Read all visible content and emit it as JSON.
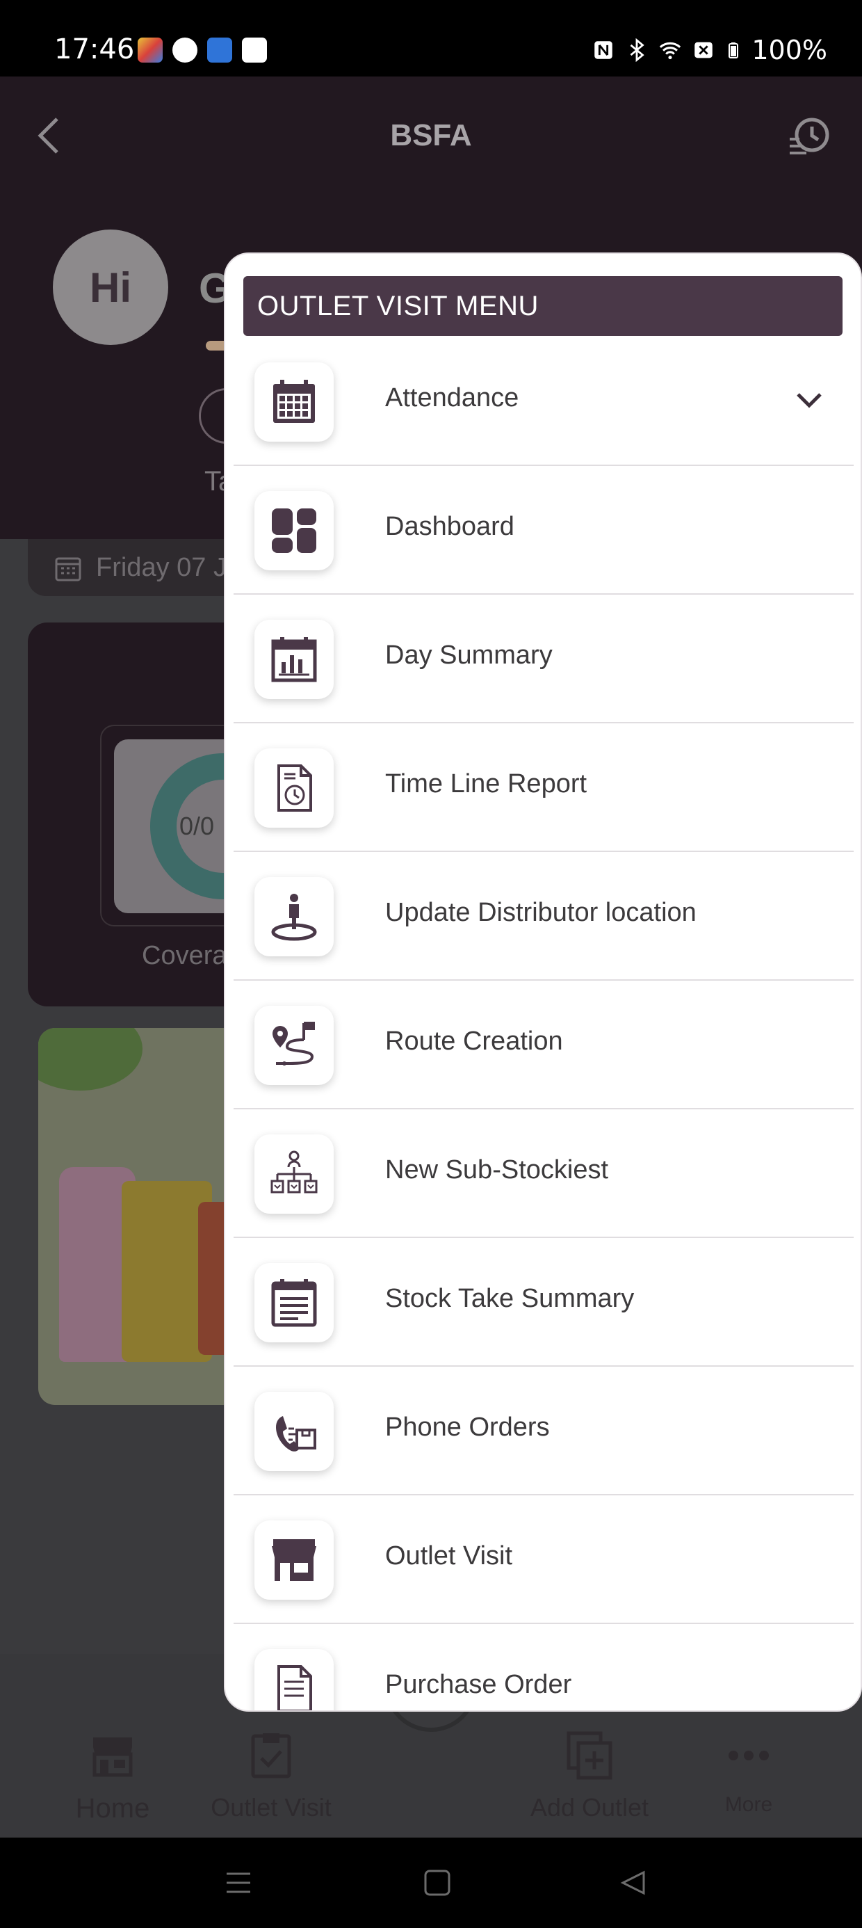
{
  "status_bar": {
    "time": "17:46",
    "battery": "100%",
    "icons": [
      "nfc-icon",
      "bluetooth-icon",
      "wifi-icon",
      "no-sim-icon",
      "battery-icon"
    ]
  },
  "app": {
    "title": "BSFA",
    "avatar_text": "Hi",
    "greeting_partial": "G",
    "tab_partial": "Ta",
    "date_partial": "Friday 07 J",
    "coverage_value": "0/0",
    "coverage_label_partial": "Covera"
  },
  "menu": {
    "header": "OUTLET VISIT MENU",
    "items": [
      {
        "label": "Attendance",
        "icon": "calendar-icon",
        "expandable": true
      },
      {
        "label": "Dashboard",
        "icon": "dashboard-icon"
      },
      {
        "label": "Day Summary",
        "icon": "day-summary-icon"
      },
      {
        "label": "Time Line Report",
        "icon": "timeline-report-icon"
      },
      {
        "label": "Update Distributor location",
        "icon": "person-location-icon"
      },
      {
        "label": "Route Creation",
        "icon": "route-icon"
      },
      {
        "label": "New Sub-Stockiest",
        "icon": "hierarchy-icon"
      },
      {
        "label": "Stock Take Summary",
        "icon": "stock-summary-icon"
      },
      {
        "label": "Phone Orders",
        "icon": "phone-order-icon"
      },
      {
        "label": "Outlet Visit",
        "icon": "store-icon"
      },
      {
        "label": "Purchase Order",
        "icon": "purchase-order-icon"
      }
    ]
  },
  "bottom_nav": {
    "items": [
      {
        "label": "Home",
        "icon": "home-store-icon"
      },
      {
        "label": "Outlet Visit",
        "icon": "outlet-visit-icon"
      },
      {
        "label": "Add Outlet",
        "icon": "add-outlet-icon"
      },
      {
        "label": "More",
        "icon": "more-icon"
      }
    ],
    "fab_icon": "upload-icon"
  },
  "colors": {
    "menu_header_bg": "#4a3848",
    "icon_color": "#4a3848",
    "app_dark": "#221820"
  }
}
